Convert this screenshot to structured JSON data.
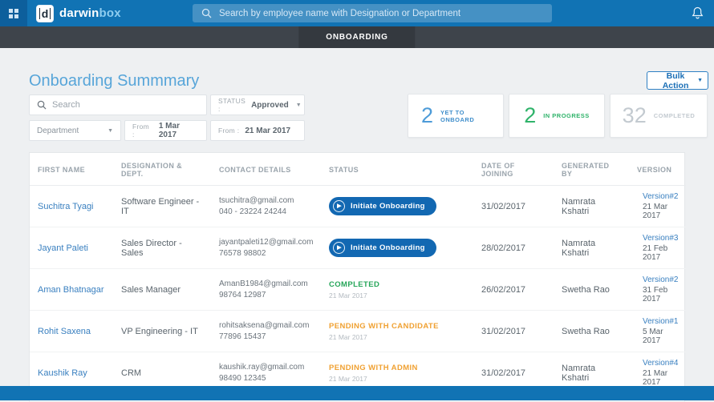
{
  "navbar": {
    "brand": {
      "logo_letter": "d",
      "name_primary": "darwin",
      "name_secondary": "box"
    },
    "search_placeholder": "Search by employee name with Designation or Department"
  },
  "subnav": {
    "tab_label": "ONBOARDING"
  },
  "page": {
    "title": "Onboarding Summmary",
    "bulk_action_label": "Bulk Action"
  },
  "filters": {
    "search_placeholder": "Search",
    "status_label": "STATUS :",
    "status_value": "Approved",
    "department_placeholder": "Department",
    "from1_label": "From :",
    "from1_value": "1 Mar 2017",
    "from2_label": "From :",
    "from2_value": "21 Mar 2017"
  },
  "stats": [
    {
      "value": "2",
      "label": "YET TO ONBOARD"
    },
    {
      "value": "2",
      "label": "IN PROGRESS"
    },
    {
      "value": "32",
      "label": "COMPLETED"
    }
  ],
  "table": {
    "headers": [
      "FIRST NAME",
      "DESIGNATION & DEPT.",
      "CONTACT DETAILS",
      "STATUS",
      "DATE OF JOINING",
      "GENERATED BY",
      "VERSION"
    ],
    "rows": [
      {
        "first_name": "Suchitra Tyagi",
        "designation": "Software Engineer - IT",
        "email": "tsuchitra@gmail.com",
        "phone": "040 - 23224 24244",
        "status": {
          "type": "button",
          "label": "Initiate Onboarding"
        },
        "date_of_joining": "31/02/2017",
        "generated_by": "Namrata Kshatri",
        "version": {
          "label": "Version#2",
          "date": "21 Mar 2017"
        }
      },
      {
        "first_name": "Jayant Paleti",
        "designation": "Sales Director - Sales",
        "email": "jayantpaleti12@gmail.com",
        "phone": "76578 98802",
        "status": {
          "type": "button",
          "label": "Initiate Onboarding"
        },
        "date_of_joining": "28/02/2017",
        "generated_by": "Namrata Kshatri",
        "version": {
          "label": "Version#3",
          "date": "21 Feb 2017"
        }
      },
      {
        "first_name": "Aman Bhatnagar",
        "designation": "Sales Manager",
        "email": "AmanB1984@gmail.com",
        "phone": "98764 12987",
        "status": {
          "type": "completed",
          "label": "COMPLETED",
          "date": "21 Mar 2017"
        },
        "date_of_joining": "26/02/2017",
        "generated_by": "Swetha Rao",
        "version": {
          "label": "Version#2",
          "date": "31 Feb 2017"
        }
      },
      {
        "first_name": "Rohit Saxena",
        "designation": "VP Engineering - IT",
        "email": "rohitsaksena@gmail.com",
        "phone": "77896 15437",
        "status": {
          "type": "pending",
          "label": "PENDING WITH CANDIDATE",
          "date": "21 Mar 2017"
        },
        "date_of_joining": "31/02/2017",
        "generated_by": "Swetha Rao",
        "version": {
          "label": "Version#1",
          "date": "5 Mar 2017"
        }
      },
      {
        "first_name": "Kaushik Ray",
        "designation": "CRM",
        "email": "kaushik.ray@gmail.com",
        "phone": "98490 12345",
        "status": {
          "type": "pending",
          "label": "PENDING WITH ADMIN",
          "date": "21 Mar 2017"
        },
        "date_of_joining": "31/02/2017",
        "generated_by": "Namrata Kshatri",
        "version": {
          "label": "Version#4",
          "date": "21 Mar 2017"
        }
      }
    ]
  },
  "icons": {
    "play": "▶",
    "caret": "▼"
  },
  "colors": {
    "navbar_blue": "#1173b4",
    "accent_blue": "#1268b2",
    "link_blue": "#3a80c0",
    "title_blue": "#57a5d9",
    "green": "#27a65a",
    "orange": "#f0a132",
    "muted_gray": "#c3cad0"
  }
}
